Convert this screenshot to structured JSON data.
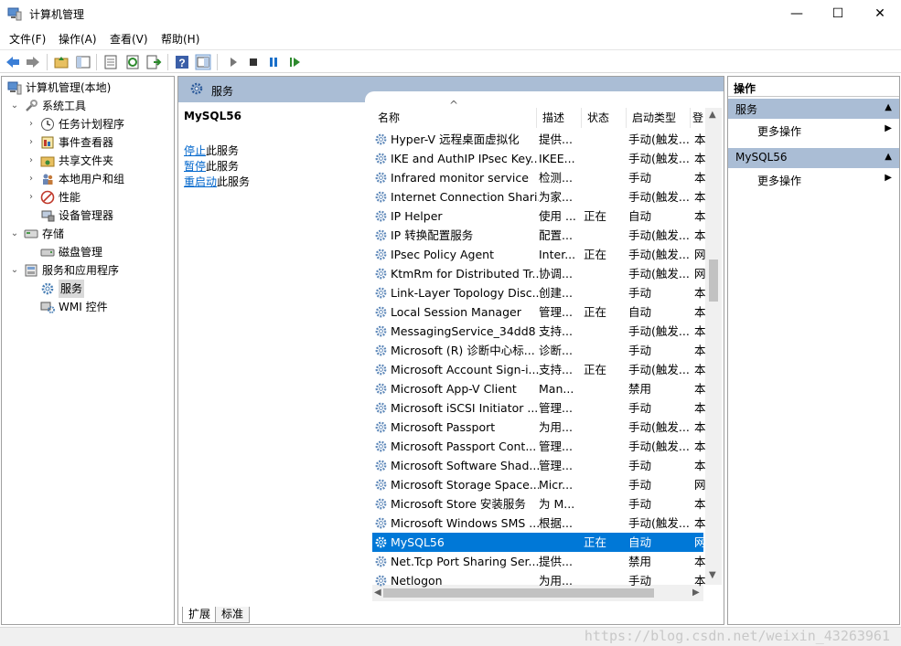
{
  "window": {
    "title": "计算机管理",
    "controls": {
      "minimize": "—",
      "maximize": "☐",
      "close": "✕"
    }
  },
  "menu": [
    "文件(F)",
    "操作(A)",
    "查看(V)",
    "帮助(H)"
  ],
  "tree": {
    "items": [
      {
        "label": "计算机管理(本地)",
        "icon": "computer-icon",
        "level": 0,
        "expander": ""
      },
      {
        "label": "系统工具",
        "icon": "tools-icon",
        "level": 1,
        "expander": "⌄"
      },
      {
        "label": "任务计划程序",
        "icon": "clock-icon",
        "level": 2,
        "expander": "›"
      },
      {
        "label": "事件查看器",
        "icon": "event-viewer-icon",
        "level": 2,
        "expander": "›"
      },
      {
        "label": "共享文件夹",
        "icon": "shared-folder-icon",
        "level": 2,
        "expander": "›"
      },
      {
        "label": "本地用户和组",
        "icon": "users-icon",
        "level": 2,
        "expander": "›"
      },
      {
        "label": "性能",
        "icon": "performance-icon",
        "level": 2,
        "expander": "›"
      },
      {
        "label": "设备管理器",
        "icon": "device-manager-icon",
        "level": 2,
        "expander": ""
      },
      {
        "label": "存储",
        "icon": "storage-icon",
        "level": 1,
        "expander": "⌄"
      },
      {
        "label": "磁盘管理",
        "icon": "disk-icon",
        "level": 2,
        "expander": ""
      },
      {
        "label": "服务和应用程序",
        "icon": "services-apps-icon",
        "level": 1,
        "expander": "⌄"
      },
      {
        "label": "服务",
        "icon": "gear-icon",
        "level": 2,
        "expander": "",
        "selected": true
      },
      {
        "label": "WMI 控件",
        "icon": "wmi-icon",
        "level": 2,
        "expander": ""
      }
    ]
  },
  "center": {
    "header": "服务",
    "extended": {
      "title": "MySQL56",
      "links": [
        {
          "link": "停止",
          "rest": "此服务"
        },
        {
          "link": "暂停",
          "rest": "此服务"
        },
        {
          "link": "重启动",
          "rest": "此服务"
        }
      ]
    },
    "columns": [
      "名称",
      "描述",
      "状态",
      "启动类型",
      "登"
    ],
    "sort_glyph": "^",
    "rows": [
      {
        "name": "Hyper-V 远程桌面虚拟化",
        "desc": "提供...",
        "status": "",
        "start": "手动(触发...",
        "logon": "本"
      },
      {
        "name": "IKE and AuthIP IPsec Key...",
        "desc": "IKEE...",
        "status": "",
        "start": "手动(触发...",
        "logon": "本"
      },
      {
        "name": "Infrared monitor service",
        "desc": "检测...",
        "status": "",
        "start": "手动",
        "logon": "本"
      },
      {
        "name": "Internet Connection Shari...",
        "desc": "为家...",
        "status": "",
        "start": "手动(触发...",
        "logon": "本"
      },
      {
        "name": "IP Helper",
        "desc": "使用 ...",
        "status": "正在",
        "start": "自动",
        "logon": "本"
      },
      {
        "name": "IP 转换配置服务",
        "desc": "配置...",
        "status": "",
        "start": "手动(触发...",
        "logon": "本"
      },
      {
        "name": "IPsec Policy Agent",
        "desc": "Inter...",
        "status": "正在",
        "start": "手动(触发...",
        "logon": "网"
      },
      {
        "name": "KtmRm for Distributed Tr...",
        "desc": "协调...",
        "status": "",
        "start": "手动(触发...",
        "logon": "网"
      },
      {
        "name": "Link-Layer Topology Disc...",
        "desc": "创建...",
        "status": "",
        "start": "手动",
        "logon": "本"
      },
      {
        "name": "Local Session Manager",
        "desc": "管理...",
        "status": "正在",
        "start": "自动",
        "logon": "本"
      },
      {
        "name": "MessagingService_34dd8",
        "desc": "支持...",
        "status": "",
        "start": "手动(触发...",
        "logon": "本"
      },
      {
        "name": "Microsoft (R) 诊断中心标...",
        "desc": "诊断...",
        "status": "",
        "start": "手动",
        "logon": "本"
      },
      {
        "name": "Microsoft Account Sign-i...",
        "desc": "支持...",
        "status": "正在",
        "start": "手动(触发...",
        "logon": "本"
      },
      {
        "name": "Microsoft App-V Client",
        "desc": "Man...",
        "status": "",
        "start": "禁用",
        "logon": "本"
      },
      {
        "name": "Microsoft iSCSI Initiator ...",
        "desc": "管理...",
        "status": "",
        "start": "手动",
        "logon": "本"
      },
      {
        "name": "Microsoft Passport",
        "desc": "为用...",
        "status": "",
        "start": "手动(触发...",
        "logon": "本"
      },
      {
        "name": "Microsoft Passport Cont...",
        "desc": "管理...",
        "status": "",
        "start": "手动(触发...",
        "logon": "本"
      },
      {
        "name": "Microsoft Software Shad...",
        "desc": "管理...",
        "status": "",
        "start": "手动",
        "logon": "本"
      },
      {
        "name": "Microsoft Storage Space...",
        "desc": "Micr...",
        "status": "",
        "start": "手动",
        "logon": "网"
      },
      {
        "name": "Microsoft Store 安装服务",
        "desc": "为 M...",
        "status": "",
        "start": "手动",
        "logon": "本"
      },
      {
        "name": "Microsoft Windows SMS ...",
        "desc": "根据...",
        "status": "",
        "start": "手动(触发...",
        "logon": "本"
      },
      {
        "name": "MySQL56",
        "desc": "",
        "status": "正在",
        "start": "自动",
        "logon": "网",
        "selected": true
      },
      {
        "name": "Net.Tcp Port Sharing Ser...",
        "desc": "提供...",
        "status": "",
        "start": "禁用",
        "logon": "本"
      },
      {
        "name": "Netlogon",
        "desc": "为用...",
        "status": "",
        "start": "手动",
        "logon": "本"
      }
    ],
    "tabs": [
      "扩展",
      "标准"
    ]
  },
  "actions": {
    "title": "操作",
    "sections": [
      {
        "label": "服务",
        "item": "更多操作"
      },
      {
        "label": "MySQL56",
        "item": "更多操作"
      }
    ]
  },
  "watermark": "https://blog.csdn.net/weixin_43263961",
  "colors": {
    "header_blue": "#aabdd5",
    "selection": "#0078d7",
    "link": "#0066cc"
  }
}
